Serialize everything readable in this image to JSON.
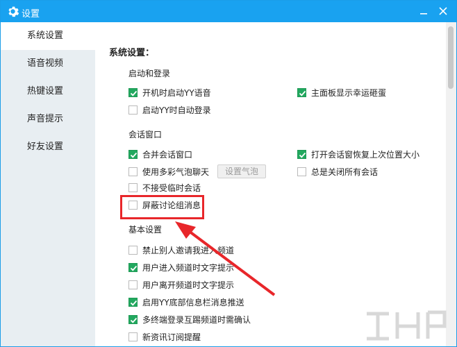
{
  "window": {
    "title": "设置",
    "icons": {
      "title": "gear-icon",
      "minimize": "minimize-icon",
      "close": "close-icon"
    }
  },
  "sidebar": {
    "items": [
      {
        "label": "系统设置",
        "active": true
      },
      {
        "label": "语音视频",
        "active": false
      },
      {
        "label": "热键设置",
        "active": false
      },
      {
        "label": "声音提示",
        "active": false
      },
      {
        "label": "好友设置",
        "active": false
      }
    ]
  },
  "main": {
    "section_title": "系统设置：",
    "startup": {
      "title": "启动和登录",
      "options": [
        {
          "label": "开机时启动YY语音",
          "checked": true
        },
        {
          "label": "主面板显示幸运砸蛋",
          "checked": true
        },
        {
          "label": "启动YY时自动登录",
          "checked": false
        }
      ]
    },
    "session": {
      "title": "会话窗口",
      "options": [
        {
          "label": "合并会话窗口",
          "checked": true
        },
        {
          "label": "打开会话窗恢复上次位置大小",
          "checked": true
        },
        {
          "label": "使用多彩气泡聊天",
          "checked": false
        },
        {
          "label": "总是关闭所有会话",
          "checked": false
        },
        {
          "label": "不接受临时会话",
          "checked": false
        },
        {
          "label": "屏蔽讨论组消息",
          "checked": false
        }
      ],
      "bubble_button": "设置气泡"
    },
    "basic": {
      "title": "基本设置",
      "options": [
        {
          "label": "禁止别人邀请我进入频道",
          "checked": false
        },
        {
          "label": "用户进入频道时文字提示",
          "checked": true
        },
        {
          "label": "用户离开频道时文字提示",
          "checked": false
        },
        {
          "label": "启用YY底部信息栏消息推送",
          "checked": true
        },
        {
          "label": "多终端登录互踢频道时需确认",
          "checked": true
        },
        {
          "label": "新资讯订阅提醒",
          "checked": false
        }
      ]
    }
  },
  "colors": {
    "titlebar": "#19a2f0",
    "checkbox_checked": "#22a85f",
    "highlight": "#e8262a",
    "sidebar_bg": "#e8eef2"
  }
}
